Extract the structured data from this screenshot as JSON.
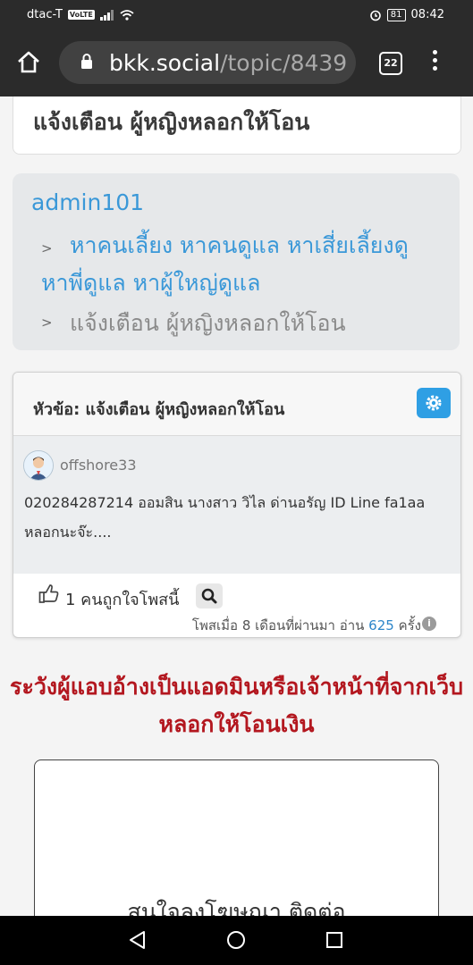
{
  "status_bar": {
    "carrier": "dtac-T",
    "volte": "VoLTE",
    "battery": "81",
    "time": "08:42"
  },
  "browser": {
    "url_host": "bkk.social",
    "url_path": "/topic/8439",
    "tab_count": "22"
  },
  "page": {
    "title": "แจ้งเตือน ผู้หญิงหลอกให้โอน",
    "breadcrumb": {
      "user": "admin101",
      "arrow": ">",
      "category": "หาคนเลี้ยง หาคนดูแล หาเสี่ยเลี้ยงดู หาพี่ดูแล หาผู้ใหญ่ดูแล",
      "current": "แจ้งเตือน ผู้หญิงหลอกให้โอน"
    },
    "topic": {
      "header": "หัวข้อ: แจ้งเตือน ผู้หญิงหลอกให้โอน",
      "author": "offshore33",
      "body": "020284287214 ออมสิน  นางสาว วิไล ด่านอรัญ  ID Line fa1aa  หลอกนะจ๊ะ....",
      "likes": "1 คนถูกใจโพสนี้",
      "posted": "โพสเมื่อ 8 เดือนที่ผ่านมา อ่าน",
      "views": "625",
      "views_unit": "ครั้ง",
      "info": "i"
    },
    "warning": "ระวังผู้แอบอ้างเป็นแอดมินหรือเจ้าหน้าที่จากเว็บ หลอกให้โอนเงิน",
    "ad_text": "สนใจลงโฆษณา ติดต่อ"
  },
  "colors": {
    "link": "#3a98d8",
    "warning": "#b3171f",
    "button_blue": "#2f9fe4",
    "chrome_dark": "#2b2b2b"
  },
  "icons": [
    "wifi-icon",
    "signal-icon",
    "alarm-icon",
    "home-icon",
    "lock-icon",
    "tabs-icon",
    "menu-icon",
    "gear-icon",
    "thumbs-up-icon",
    "search-icon",
    "info-icon",
    "back-icon",
    "home-nav-icon",
    "recents-icon"
  ]
}
